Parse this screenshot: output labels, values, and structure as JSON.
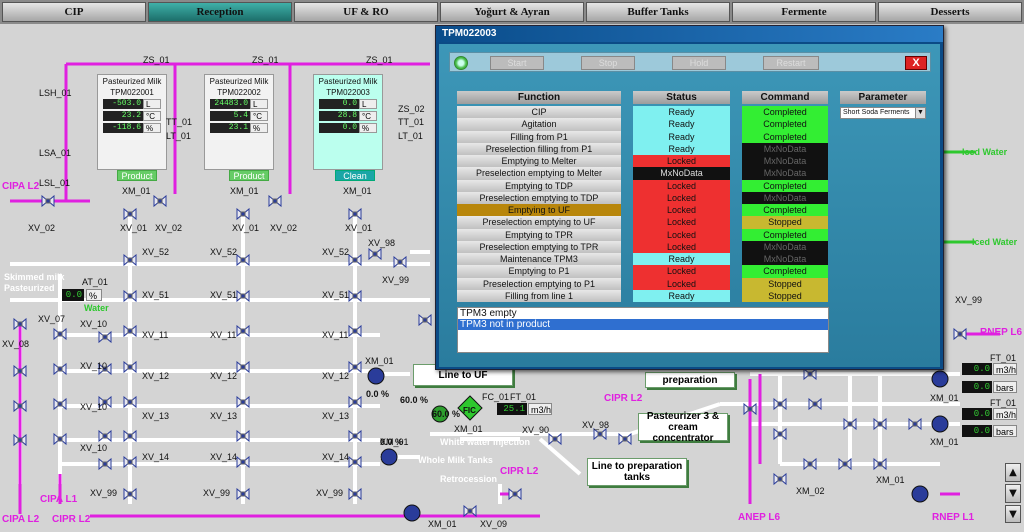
{
  "nav": {
    "tabs": [
      "CIP",
      "Reception",
      "UF & RO",
      "Yoğurt & Ayran",
      "Buffer Tanks",
      "Fermente",
      "Desserts"
    ],
    "active_index": 1
  },
  "tanks": [
    {
      "title_l1": "Pasteurized Milk",
      "title_l2": "TPM022001",
      "level": "-503.0",
      "level_unit": "L",
      "temp": "23.2",
      "temp_unit": "°C",
      "pct": "-118.6",
      "pct_unit": "%",
      "state": "Product"
    },
    {
      "title_l1": "Pasteurized Milk",
      "title_l2": "TPM022002",
      "level": "24483.0",
      "level_unit": "L",
      "temp": "5.4",
      "temp_unit": "°C",
      "pct": "23.1",
      "pct_unit": "%",
      "state": "Product"
    },
    {
      "title_l1": "Pasteurized Milk",
      "title_l2": "TPM022003",
      "level": "0.0",
      "level_unit": "L",
      "temp": "28.8",
      "temp_unit": "°C",
      "pct": "0.0",
      "pct_unit": "%",
      "state": "Clean"
    }
  ],
  "tank_tags": {
    "zs": "ZS_01",
    "lsh": "LSH_01",
    "tt": "TT_01",
    "lt": "LT_01",
    "lsa": "LSA_01",
    "lsl": "LSL_01",
    "xm": "XM_01",
    "zs6": "ZS_02"
  },
  "labels": {
    "cipa_l2": "CIPA L2",
    "cipa_l1": "CIPA L1",
    "cipa_l2b": "CIPA L2",
    "cipr_l2": "CIPR L2",
    "cipr_l2b": "CIPR L2",
    "cipr_l2c": "CIPR L2",
    "anep_l6": "ANEP L6",
    "rnep_l6": "RNEP L6",
    "rnep_l1": "RNEP L1",
    "iced_water1": "Iced Water",
    "iced_water2": "Iced Water",
    "skimmed": "Skimmed milk",
    "pasteurized": "Pasteurized",
    "water": "Water",
    "white_water": "White water injection",
    "whole_milk": "Whole Milk Tanks",
    "retrocession": "Retrocession",
    "at_tag": "AT_01",
    "at_val": "0.0",
    "at_unit": "%",
    "fc_tag": "FC_01",
    "fc_pct": "60.0 %",
    "fc_pct2": "60.0 %",
    "fic": "FIC",
    "ft_val": "25.1",
    "ft_unit": "m3/h",
    "ft_tag": "FT_01",
    "pump_pct1": "0.0 %",
    "pump_pct2": "0.0 %",
    "right_ft_tag": "FT_01",
    "right_ft_val": "0.0",
    "right_ft_unit": "m3/h",
    "right_bar_val": "0.0",
    "right_bar_unit": "bars",
    "right_ft2_tag": "FT_01",
    "right_ft2_val": "0.0",
    "right_ft2_unit": "m3/h",
    "right_bar2_val": "0.0",
    "right_bar2_unit": "bars",
    "xv_01": "XV_01",
    "xv_02": "XV_02",
    "xv_52": "XV_52",
    "xv_51": "XV_51",
    "xv_11": "XV_11",
    "xv_12": "XV_12",
    "xv_13": "XV_13",
    "xv_14": "XV_14",
    "xv_10": "XV_10",
    "xv_07": "XV_07",
    "xv_08": "XV_08",
    "xv_99": "XV_99",
    "xv_90": "XV_90",
    "xv_98": "XV_98",
    "xv_09": "XV_09",
    "xm_01": "XM_01",
    "xm_02": "XM_02"
  },
  "boxes": {
    "line_uf": "Line to UF",
    "preparation": "preparation",
    "past3_l1": "Pasteurizer 3 & cream",
    "past3_l2": "concentrator",
    "prep_tanks_l1": "Line to preparation",
    "prep_tanks_l2": "tanks"
  },
  "dialog": {
    "title": "TPM022003",
    "buttons": {
      "start": "Start",
      "stop": "Stop",
      "hold": "Hold",
      "restart": "Restart",
      "close": "X"
    },
    "headers": {
      "function": "Function",
      "status": "Status",
      "command": "Command",
      "parameter": "Parameter"
    },
    "parameter_value": "Short Soda Ferments",
    "selected_row": 8,
    "rows": [
      {
        "function": "CIP",
        "status": "Ready",
        "command": "Completed"
      },
      {
        "function": "Agitation",
        "status": "Ready",
        "command": "Completed"
      },
      {
        "function": "Filling from P1",
        "status": "Ready",
        "command": "Completed"
      },
      {
        "function": "Preselection filling from P1",
        "status": "Ready",
        "command": "MxNoData"
      },
      {
        "function": "Emptying to Melter",
        "status": "Locked",
        "command": "MxNoData"
      },
      {
        "function": "Preselection emptying to Melter",
        "status": "MxNoData",
        "command": "MxNoData"
      },
      {
        "function": "Emptying to TDP",
        "status": "Locked",
        "command": "Completed"
      },
      {
        "function": "Preselection emptying to TDP",
        "status": "Locked",
        "command": "MxNoData"
      },
      {
        "function": "Emptying to UF",
        "status": "Locked",
        "command": "Completed"
      },
      {
        "function": "Preselection emptying to UF",
        "status": "Locked",
        "command": "Stopped"
      },
      {
        "function": "Emptying to TPR",
        "status": "Locked",
        "command": "Completed"
      },
      {
        "function": "Preselection emptying to TPR",
        "status": "Locked",
        "command": "MxNoData"
      },
      {
        "function": "Maintenance TPM3",
        "status": "Ready",
        "command": "MxNoData"
      },
      {
        "function": "Emptying to P1",
        "status": "Locked",
        "command": "Completed"
      },
      {
        "function": "Preselection emptying to P1",
        "status": "Locked",
        "command": "Stopped"
      },
      {
        "function": "Filling from line 1",
        "status": "Ready",
        "command": "Stopped"
      }
    ],
    "messages": [
      "TPM3 empty",
      "TPM3 not in product"
    ],
    "selected_message": 1
  },
  "colors": {
    "ready": "#7ff0f0",
    "locked": "#ee3030",
    "mxnodata": "#111111",
    "completed": "#33ee33",
    "stopped": "#c8b830",
    "pipe_cip": "#e020e0",
    "pipe_white": "#ffffff",
    "pipe_green": "#2ec82e"
  },
  "scroll": {
    "up": "▲",
    "down": "▼"
  }
}
